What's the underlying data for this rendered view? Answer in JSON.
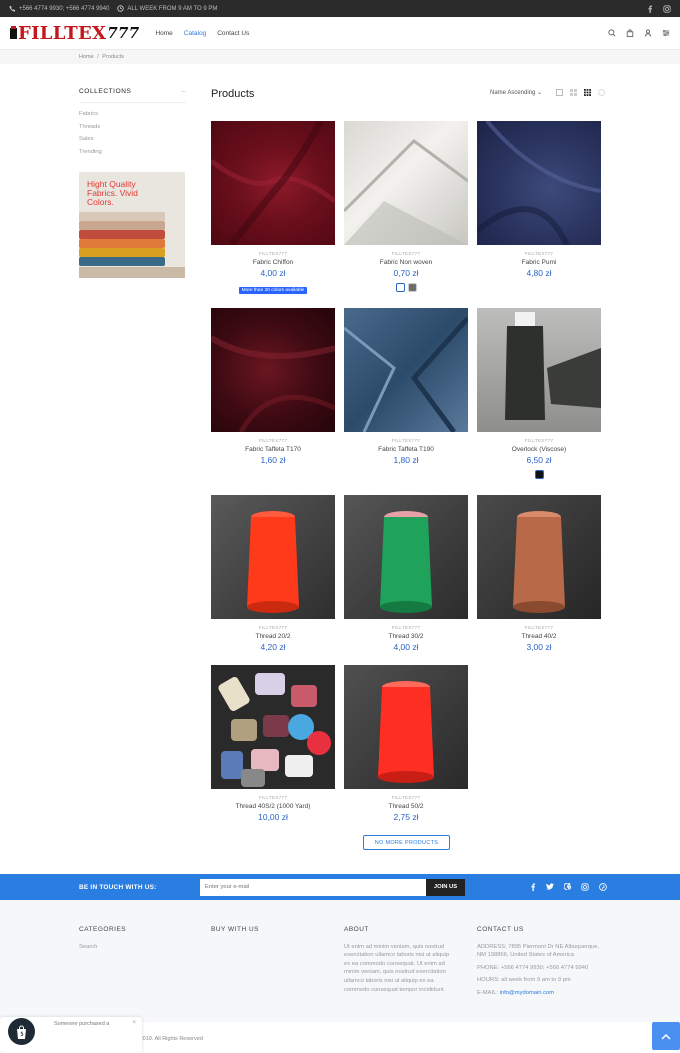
{
  "topbar": {
    "phones": "+566 4774 9930; +566 4774 9940",
    "hours": "ALL WEEK FROM 9 AM TO 9 PM",
    "icons": [
      "phone-icon",
      "clock-icon",
      "facebook-icon",
      "instagram-icon"
    ]
  },
  "header": {
    "logo_main": "FILLTEX",
    "logo_num": "777",
    "nav": [
      {
        "label": "Home"
      },
      {
        "label": "Catalog"
      },
      {
        "label": "Contact Us"
      }
    ],
    "icons": [
      "search-icon",
      "bag-icon",
      "user-icon",
      "settings-icon"
    ]
  },
  "breadcrumb": {
    "home": "Home",
    "sep": "/",
    "current": "Products"
  },
  "sidebar": {
    "heading": "COLLECTIONS",
    "items": [
      {
        "label": "Fabrics"
      },
      {
        "label": "Threads"
      },
      {
        "label": "Sales"
      },
      {
        "label": "Trending"
      }
    ],
    "promo_text": "Hight Quality Fabrics. Vivid Colors."
  },
  "main": {
    "title": "Products",
    "sort": "Name Ascending"
  },
  "products": [
    {
      "vendor": "FILLTEX777",
      "name": "Fabric Chiffon",
      "price": "4,00 zł",
      "badge": "More than 20 colors available"
    },
    {
      "vendor": "FILLTEX777",
      "name": "Fabric Non woven",
      "price": "0,70 zł"
    },
    {
      "vendor": "FILLTEX777",
      "name": "Fabric Pumi",
      "price": "4,80 zł"
    },
    {
      "vendor": "FILLTEX777",
      "name": "Fabric Taffeta T170",
      "price": "1,60 zł"
    },
    {
      "vendor": "FILLTEX777",
      "name": "Fabric Taffeta T190",
      "price": "1,80 zł"
    },
    {
      "vendor": "FILLTEX777",
      "name": "Overlock (Viscose)",
      "price": "6,50 zł"
    },
    {
      "vendor": "FILLTEX777",
      "name": "Thread 20/2",
      "price": "4,20 zł"
    },
    {
      "vendor": "FILLTEX777",
      "name": "Thread 30/2",
      "price": "4,00 zł"
    },
    {
      "vendor": "FILLTEX777",
      "name": "Thread 40/2",
      "price": "3,00 zł"
    },
    {
      "vendor": "FILLTEX777",
      "name": "Thread 40S/2 (1000 Yard)",
      "price": "10,00 zł"
    },
    {
      "vendor": "FILLTEX777",
      "name": "Thread 50/2",
      "price": "2,75 zł"
    }
  ],
  "no_more": "NO MORE PRODUCTS",
  "newsletter": {
    "label": "BE IN TOUCH WITH US:",
    "placeholder": "Enter your e-mail",
    "button": "JOIN US",
    "icons": [
      "facebook-icon",
      "twitter-icon",
      "google-icon",
      "instagram-icon",
      "pinterest-icon"
    ]
  },
  "footer": {
    "categories": {
      "heading": "CATEGORIES",
      "items": [
        "Search"
      ]
    },
    "buy": {
      "heading": "BUY WITH US"
    },
    "about": {
      "heading": "ABOUT",
      "text": "Ut enim ad minim veniam, quis nostrud exercitation ullamco laboris nisi ut aliquip ex ea commodo consequat. Ut enim ad minim veniam, quis nostrud exercitation ullamco laboris nisi ut aliquip ex ea commodo consequat tempor incididunt."
    },
    "contact": {
      "heading": "CONTACT US",
      "address": "ADDRESS: 7895 Piermont Dr NE Albuquerque, NM 198866, United States of America",
      "phone": "PHONE: +566 4774 9930; +566 4774 9940",
      "hours": "HOURS: all week from 9 am to 9 pm",
      "email_label": "E-MAIL:",
      "email": "info@mydomain.com"
    }
  },
  "copyright": "e 2019. All Rights Reserved",
  "toast": {
    "text": "Someone purchased a",
    "close": "×"
  }
}
